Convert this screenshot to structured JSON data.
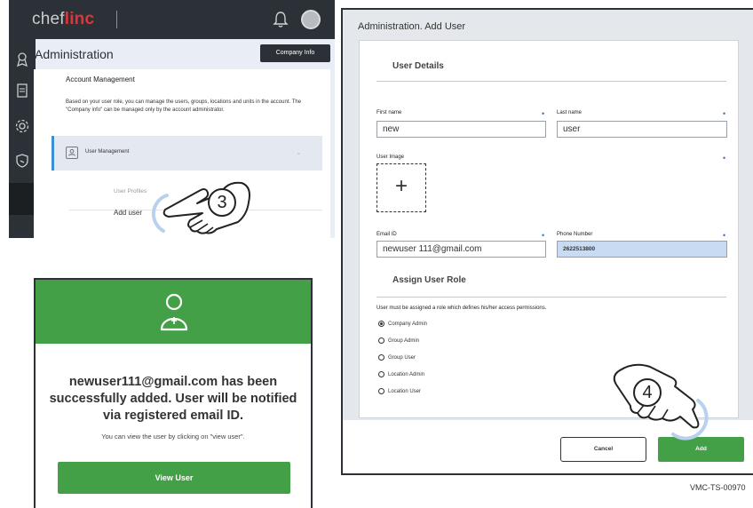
{
  "app": {
    "logo_part1": "chef",
    "logo_part2": "linc",
    "page_title": "Administration",
    "company_info_label": "Company Info"
  },
  "account_management": {
    "title": "Account Management",
    "description": "Based on your user role, you can manage the users, groups, locations and units in the account. The \"Company info\" can be managed only by the account administrator.",
    "user_management_label": "User Management",
    "user_profiles_label": "User Profiles",
    "add_user_label": "Add user"
  },
  "callouts": {
    "step3": "3",
    "step4": "4"
  },
  "success_dialog": {
    "message": "newuser111@gmail.com has been successfully added. User will be notified via registered email ID.",
    "sub_message": "You can view the user by clicking on \"view user\".",
    "view_user_label": "View User",
    "colors": {
      "header": "#43a047",
      "button": "#43a047"
    }
  },
  "add_user_dialog": {
    "title": "Administration. Add User",
    "user_details_title": "User Details",
    "first_name_label": "First name",
    "first_name_value": "new",
    "last_name_label": "Last name",
    "last_name_value": "user",
    "user_image_label": "User Image",
    "email_label": "Email ID",
    "email_value": "newuser 111@gmail.com",
    "phone_label": "Phone Number",
    "phone_value": "2622513800",
    "assign_role_title": "Assign User Role",
    "role_note": "User must be assigned a role which defines his/her access permissions.",
    "roles": [
      {
        "label": "Company Admin",
        "selected": true
      },
      {
        "label": "Group Admin",
        "selected": false
      },
      {
        "label": "Group User",
        "selected": false
      },
      {
        "label": "Location Admin",
        "selected": false
      },
      {
        "label": "Location User",
        "selected": false
      }
    ],
    "cancel_label": "Cancel",
    "add_label": "Add"
  },
  "reference_code": "VMC-TS-00970",
  "icons": {
    "bell": "bell-icon",
    "avatar": "avatar",
    "sidebar": [
      "award-icon",
      "document-icon",
      "gear-icon",
      "shield-icon"
    ],
    "user_management": "user-icon",
    "success_user": "user-icon",
    "image_upload": "plus-icon",
    "hand_cursor": "pointing-hand-icon"
  }
}
